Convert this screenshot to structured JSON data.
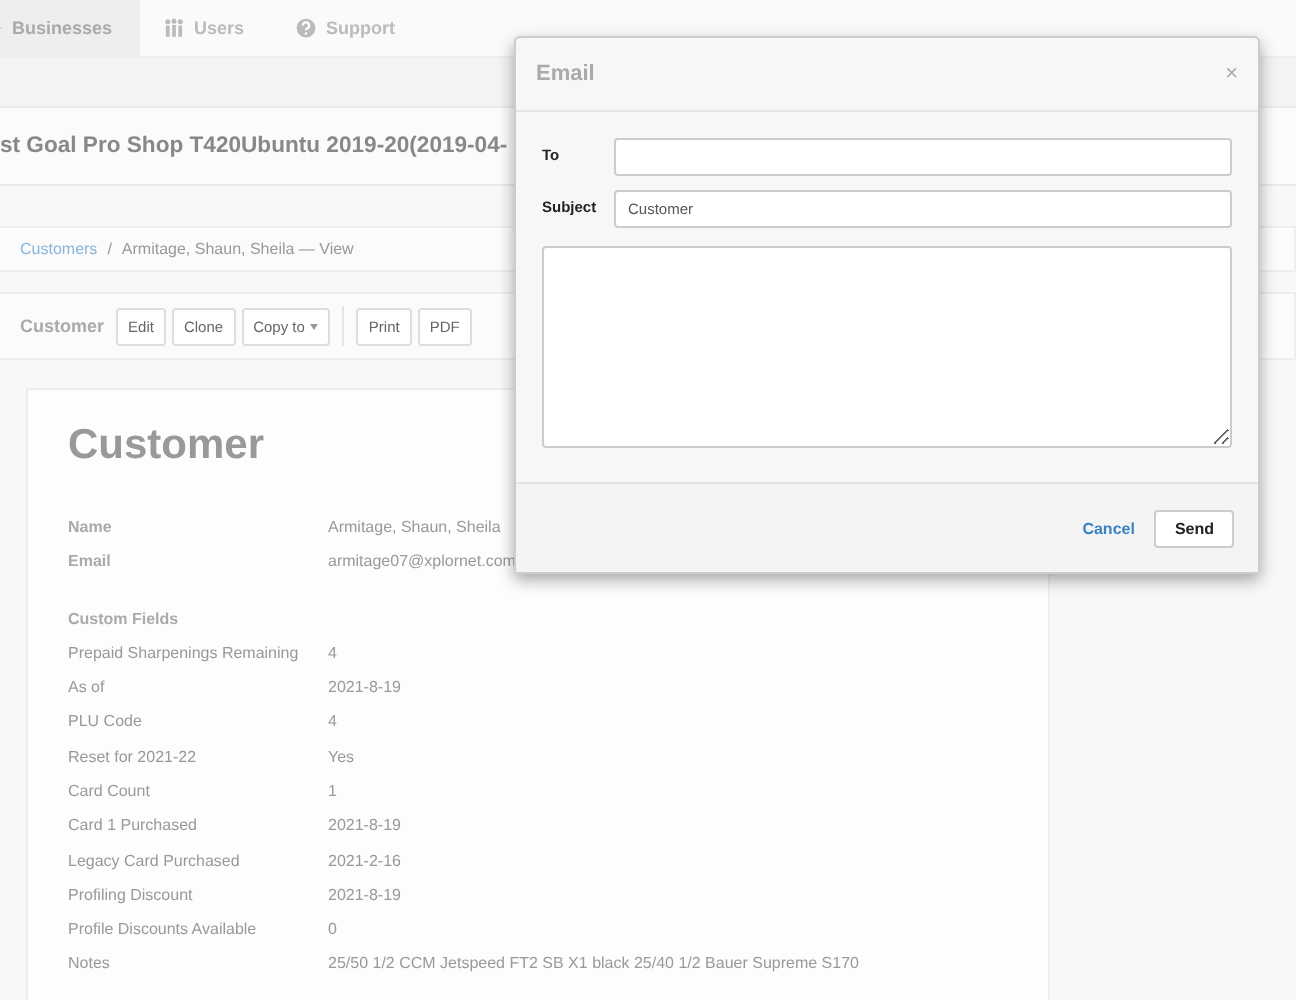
{
  "nav": {
    "tabs": [
      {
        "label": "Businesses",
        "selected": true
      },
      {
        "label": "Users",
        "selected": false
      },
      {
        "label": "Support",
        "selected": false
      }
    ]
  },
  "page_title": "st Goal Pro Shop T420Ubuntu 2019-20(2019-04-",
  "breadcrumb": {
    "link": "Customers",
    "separator": "/",
    "current": "Armitage, Shaun, Sheila — View"
  },
  "toolbar": {
    "label": "Customer",
    "groups": [
      [
        {
          "label": "Edit",
          "caret": false
        },
        {
          "label": "Clone",
          "caret": false
        },
        {
          "label": "Copy to",
          "caret": true
        }
      ],
      [
        {
          "label": "Print",
          "caret": false
        },
        {
          "label": "PDF",
          "caret": false
        }
      ]
    ]
  },
  "card": {
    "heading": "Customer",
    "fields": [
      {
        "label": "Name",
        "value": "Armitage, Shaun, Sheila"
      },
      {
        "label": "Email",
        "value": "armitage07@xplornet.com"
      }
    ],
    "section": "Custom Fields",
    "custom_fields": [
      {
        "label": "Prepaid Sharpenings Remaining",
        "value": "4"
      },
      {
        "label": "As of",
        "value": "2021-8-19"
      },
      {
        "label": "PLU Code",
        "value": "4"
      },
      {
        "label": "Reset for 2021-22",
        "value": "Yes"
      },
      {
        "label": "Card Count",
        "value": "1"
      },
      {
        "label": "Card 1 Purchased",
        "value": "2021-8-19"
      },
      {
        "label": "Legacy Card Purchased",
        "value": "2021-2-16"
      },
      {
        "label": "Profiling Discount",
        "value": "2021-8-19"
      },
      {
        "label": "Profile Discounts Available",
        "value": "0"
      },
      {
        "label": "Notes",
        "value": "25/50 1/2 CCM Jetspeed FT2 SB X1 black 25/40 1/2 Bauer Supreme S170"
      }
    ]
  },
  "dialog": {
    "title": "Email",
    "close": "×",
    "fields": [
      {
        "label": "To"
      },
      {
        "label": "Subject",
        "value": "Customer"
      }
    ],
    "cancel": "Cancel",
    "send": "Send"
  }
}
